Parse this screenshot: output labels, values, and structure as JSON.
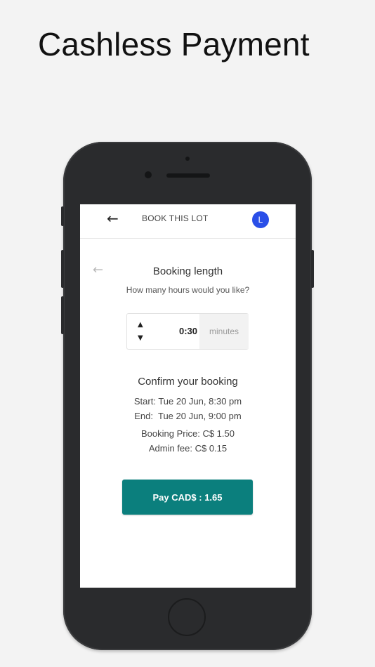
{
  "headline": "Cashless Payment",
  "app": {
    "topbar": {
      "back_icon": "arrow-left-icon",
      "title": "BOOK THIS LOT",
      "avatar_letter": "L",
      "avatar_color": "#2a4fe8"
    },
    "booking": {
      "back_icon": "arrow-left-icon",
      "heading": "Booking length",
      "question": "How many hours would you like?",
      "duration_value": "0:30",
      "duration_unit": "minutes"
    },
    "confirm": {
      "heading": "Confirm your booking",
      "start": "Start: Tue 20 Jun, 8:30 pm",
      "end": "End:  Tue 20 Jun, 9:00 pm",
      "price": "Booking Price: C$ 1.50",
      "admin_fee": "Admin fee: C$ 0.15"
    },
    "pay_button": "Pay CAD$ : 1.65",
    "accent_color": "#0b7f7d"
  }
}
